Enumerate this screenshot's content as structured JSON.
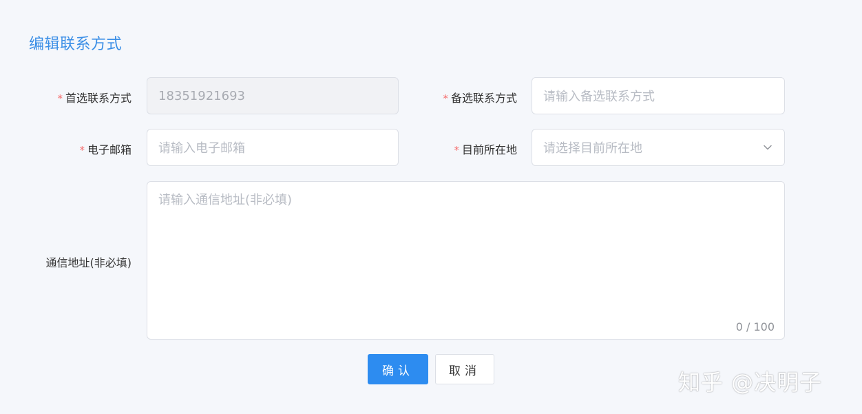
{
  "dialog": {
    "title": "编辑联系方式"
  },
  "form": {
    "primary_contact": {
      "required_mark": "*",
      "label": "首选联系方式",
      "value": "18351921693",
      "disabled": true
    },
    "alternate_contact": {
      "required_mark": "*",
      "label": "备选联系方式",
      "placeholder": "请输入备选联系方式"
    },
    "email": {
      "required_mark": "*",
      "label": "电子邮箱",
      "placeholder": "请输入电子邮箱"
    },
    "current_location": {
      "required_mark": "*",
      "label": "目前所在地",
      "placeholder": "请选择目前所在地",
      "icon": "chevron-down-icon"
    },
    "mailing_address": {
      "label": "通信地址(非必填)",
      "placeholder": "请输入通信地址(非必填)",
      "char_count": "0 / 100"
    }
  },
  "buttons": {
    "confirm_label": "确认",
    "cancel_label": "取消"
  },
  "watermark": {
    "text": "知乎 @决明子"
  },
  "colors": {
    "accent": "#2d8cf0",
    "title": "#3a8ee6",
    "required": "#f56c6c",
    "background": "#f5f7fb"
  }
}
